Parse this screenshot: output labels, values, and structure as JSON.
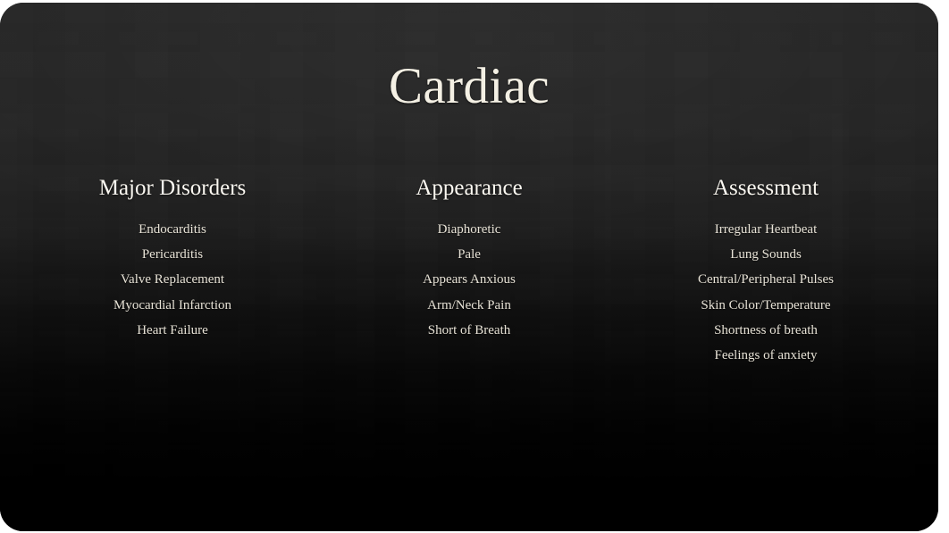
{
  "slide": {
    "title": "Cardiac",
    "background": {
      "top_color": "#262626",
      "bottom_color": "#000000",
      "title_color": "#f4f0e4",
      "heading_color": "#fbf8f1",
      "body_color": "#e7e2d6"
    },
    "columns": [
      {
        "heading": "Major Disorders",
        "items": [
          "Endocarditis",
          "Pericarditis",
          "Valve Replacement",
          "Myocardial Infarction",
          "Heart Failure"
        ]
      },
      {
        "heading": "Appearance",
        "items": [
          "Diaphoretic",
          "Pale",
          "Appears Anxious",
          "Arm/Neck Pain",
          "Short of Breath"
        ]
      },
      {
        "heading": "Assessment",
        "items": [
          "Irregular Heartbeat",
          "Lung Sounds",
          "Central/Peripheral Pulses",
          "Skin Color/Temperature",
          "Shortness of breath",
          "Feelings of anxiety"
        ]
      }
    ]
  }
}
